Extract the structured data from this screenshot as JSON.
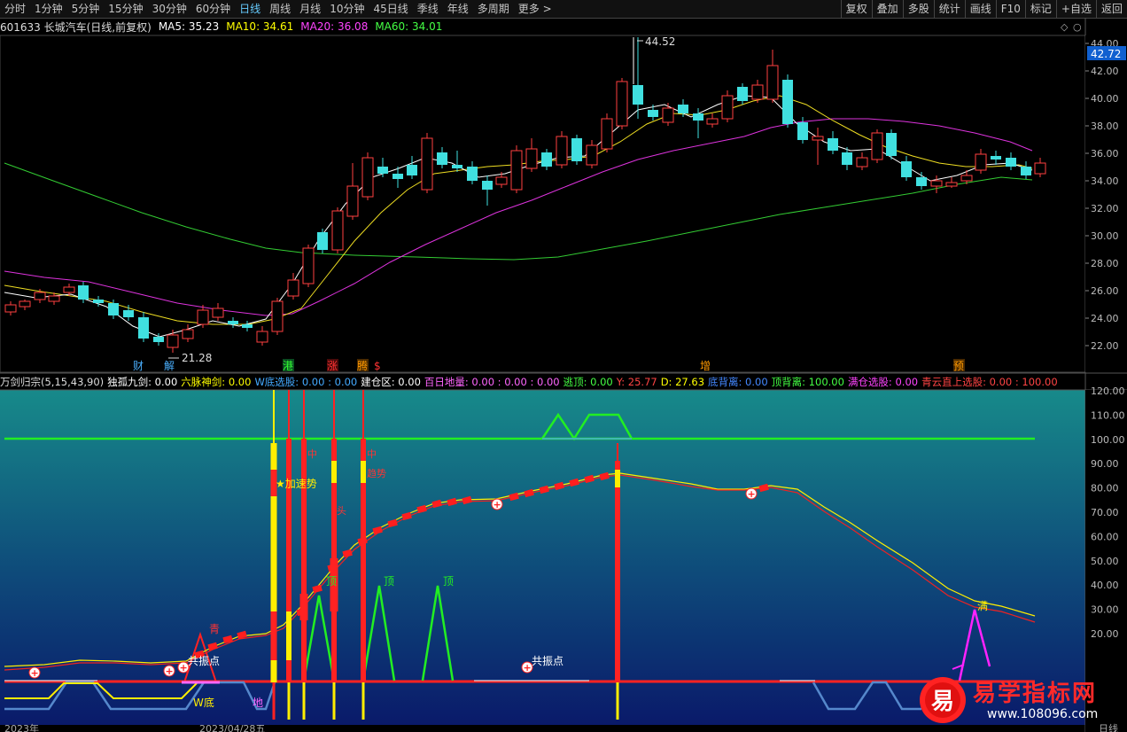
{
  "toolbar": {
    "periods": [
      "分时",
      "1分钟",
      "5分钟",
      "15分钟",
      "30分钟",
      "60分钟",
      "日线",
      "周线",
      "月线",
      "10分钟",
      "45日线",
      "季线",
      "年线",
      "多周期",
      "更多 >"
    ],
    "active_period": "日线",
    "right_buttons": [
      "复权",
      "叠加",
      "多股",
      "统计",
      "画线",
      "F10",
      "标记",
      "+自选",
      "返回"
    ]
  },
  "info": {
    "code_name": "601633 长城汽车(日线,前复权)",
    "ma": [
      {
        "label": "MA5: 35.23",
        "color": "#ffffff"
      },
      {
        "label": "MA10: 34.61",
        "color": "#ffff00"
      },
      {
        "label": "MA20: 36.08",
        "color": "#ff44ff"
      },
      {
        "label": "MA60: 34.01",
        "color": "#44ff44"
      }
    ]
  },
  "price_axis": {
    "ticks": [
      "44.00",
      "42.00",
      "40.00",
      "38.00",
      "36.00",
      "34.00",
      "32.00",
      "30.00",
      "28.00",
      "26.00",
      "24.00",
      "22.00"
    ],
    "current_price": "42.72",
    "high_label": "44.52",
    "low_label": "21.28"
  },
  "event_markers": [
    {
      "label": "财",
      "color": "#4ab0ff"
    },
    {
      "label": "解",
      "color": "#4ab0ff"
    },
    {
      "label": "港",
      "color": "#33cc33"
    },
    {
      "label": "涨",
      "color": "#ff3333"
    },
    {
      "label": "腾",
      "color": "#ff9900"
    },
    {
      "label": "$",
      "color": "#ff3333"
    },
    {
      "label": "增",
      "color": "#ff9900"
    },
    {
      "label": "预",
      "color": "#ff9900"
    }
  ],
  "indicator_bar": [
    {
      "label": "万剑归宗(5,15,43,90)",
      "color": "#dddddd"
    },
    {
      "label": "独孤九剑: 0.00",
      "color": "#ffffff"
    },
    {
      "label": "六脉神剑: 0.00",
      "color": "#ffff00"
    },
    {
      "label": "W底选股: 0.00 : 0.00",
      "color": "#44aaff"
    },
    {
      "label": "建仓区: 0.00",
      "color": "#ffffff"
    },
    {
      "label": "百日地量: 0.00 : 0.00 : 0.00",
      "color": "#ff66ff"
    },
    {
      "label": "逃顶: 0.00",
      "color": "#44ff44"
    },
    {
      "label": "Y: 25.77",
      "color": "#ff4444"
    },
    {
      "label": "D: 27.63",
      "color": "#ffff00"
    },
    {
      "label": "底背离: 0.00",
      "color": "#4488ff"
    },
    {
      "label": "顶背离: 100.00",
      "color": "#44ff44"
    },
    {
      "label": "满仓选股: 0.00",
      "color": "#ff44ff"
    },
    {
      "label": "青云直上选股: 0.00 : 100.00",
      "color": "#ff4444"
    }
  ],
  "indicator_axis": {
    "ticks": [
      "120.00",
      "110.00",
      "100.00",
      "90.00",
      "80.00",
      "70.00",
      "60.00",
      "50.00",
      "40.00",
      "30.00",
      "20.00"
    ]
  },
  "annotations": [
    {
      "label": "青",
      "color": "#ff3333"
    },
    {
      "label": "共振点",
      "color": "#ffffff"
    },
    {
      "label": "共振点",
      "color": "#ffffff"
    },
    {
      "label": "W底",
      "color": "#ffff00"
    },
    {
      "label": "地",
      "color": "#ff66ff"
    },
    {
      "label": "★加速势",
      "color": "#ffff00"
    },
    {
      "label": "中",
      "color": "#ff3333"
    },
    {
      "label": "中",
      "color": "#ff3333"
    },
    {
      "label": "趋势",
      "color": "#ff3333"
    },
    {
      "label": "头",
      "color": "#ff3333"
    },
    {
      "label": "顶",
      "color": "#44ff44"
    },
    {
      "label": "顶",
      "color": "#44ff44"
    },
    {
      "label": "顶",
      "color": "#44ff44"
    },
    {
      "label": "满",
      "color": "#ffff00"
    }
  ],
  "bottom_axis": {
    "labels": [
      "2023年",
      "2023/04/28五",
      "日线"
    ]
  },
  "logo": {
    "text": "易学指标网",
    "url": "www.108096.com",
    "glyph": "易"
  }
}
